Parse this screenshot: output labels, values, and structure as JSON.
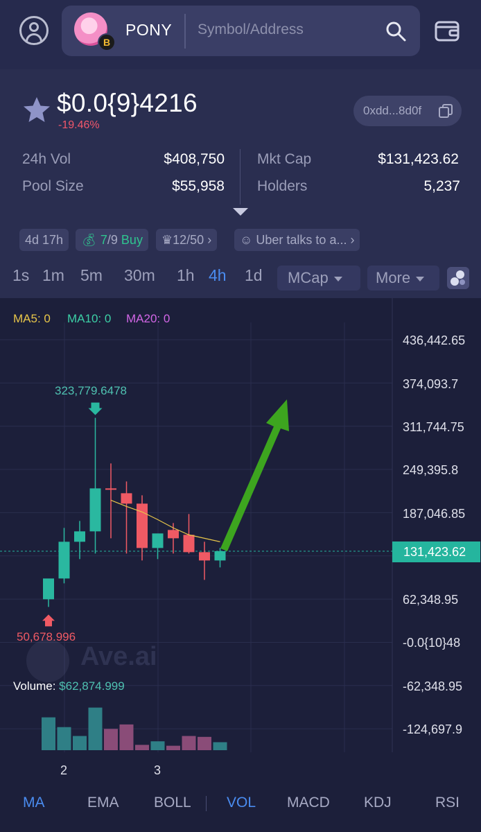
{
  "header": {
    "token_symbol": "PONY",
    "chain_badge": "B",
    "search_placeholder": "Symbol/Address",
    "icons": [
      "user-icon",
      "search-icon",
      "wallet-icon"
    ]
  },
  "token": {
    "price": "$0.0{9}4216",
    "change": "-19.46%",
    "address": "0xdd...8d0f",
    "stats": {
      "vol_label": "24h Vol",
      "vol_value": "$408,750",
      "mcap_label": "Mkt Cap",
      "mcap_value": "$131,423.62",
      "pool_label": "Pool Size",
      "pool_value": "$55,958",
      "holders_label": "Holders",
      "holders_value": "5,237"
    },
    "tags": {
      "age": "4d 17h",
      "buy_count": "7",
      "buy_total": "/9",
      "buy_label": "Buy",
      "rank": "12/50",
      "news": "Uber talks to a..."
    }
  },
  "timeframes": [
    "1s",
    "1m",
    "5m",
    "30m",
    "1h",
    "4h",
    "1d"
  ],
  "active_timeframe": "4h",
  "controls": {
    "mcap": "MCap",
    "more": "More"
  },
  "chart_legend": {
    "ma5": "MA5: 0",
    "ma10": "MA10: 0",
    "ma20": "MA20: 0",
    "volume_label": "Volume:",
    "volume_value": "$62,874.999",
    "watermark": "Ave.ai"
  },
  "chart_data": {
    "type": "candlestick",
    "y_axis_labels": [
      "436,442.65",
      "374,093.7",
      "311,744.75",
      "249,395.8",
      "187,046.85",
      "131,423.62",
      "62,348.95",
      "-0.0{10}48",
      "-62,348.95",
      "-124,697.9"
    ],
    "x_axis_labels": [
      "2",
      "3"
    ],
    "current_value": "131,423.62",
    "max_label": "323,779.6478",
    "min_label": "50,678.996",
    "candles": [
      {
        "o": 62000,
        "h": 82000,
        "l": 51000,
        "c": 92000
      },
      {
        "o": 92000,
        "h": 165000,
        "l": 85000,
        "c": 145000
      },
      {
        "o": 145000,
        "h": 175000,
        "l": 120000,
        "c": 160000
      },
      {
        "o": 160000,
        "h": 323780,
        "l": 128000,
        "c": 222000
      },
      {
        "o": 222000,
        "h": 258000,
        "l": 150000,
        "c": 220000
      },
      {
        "o": 215000,
        "h": 232000,
        "l": 128000,
        "c": 200000
      },
      {
        "o": 200000,
        "h": 212000,
        "l": 118000,
        "c": 136000
      },
      {
        "o": 136000,
        "h": 150000,
        "l": 120000,
        "c": 157000
      },
      {
        "o": 162000,
        "h": 172000,
        "l": 128000,
        "c": 150000
      },
      {
        "o": 155000,
        "h": 185000,
        "l": 128000,
        "c": 130000
      },
      {
        "o": 130000,
        "h": 145000,
        "l": 90000,
        "c": 118000
      },
      {
        "o": 118000,
        "h": 136000,
        "l": 108000,
        "c": 131423
      }
    ],
    "volumes": [
      0.74,
      0.52,
      0.32,
      0.96,
      0.48,
      0.58,
      0.12,
      0.2,
      0.1,
      0.32,
      0.3,
      0.18
    ],
    "volume_colors": [
      "teal",
      "teal",
      "teal",
      "teal",
      "red",
      "red",
      "red",
      "teal",
      "red",
      "red",
      "red",
      "teal"
    ],
    "ma_line": [
      null,
      null,
      null,
      null,
      205000,
      196000,
      188000,
      177000,
      165000,
      155000,
      150000,
      145000
    ]
  },
  "indicator_tabs": [
    "MA",
    "EMA",
    "BOLL",
    "VOL",
    "MACD",
    "KDJ",
    "RSI"
  ],
  "active_indicators": [
    "MA",
    "VOL"
  ],
  "colors": {
    "up": "#2ab8a0",
    "down": "#f05a64",
    "accent": "#4a8cf0",
    "price_tag": "#25b59e",
    "arrow": "#3da51f"
  }
}
